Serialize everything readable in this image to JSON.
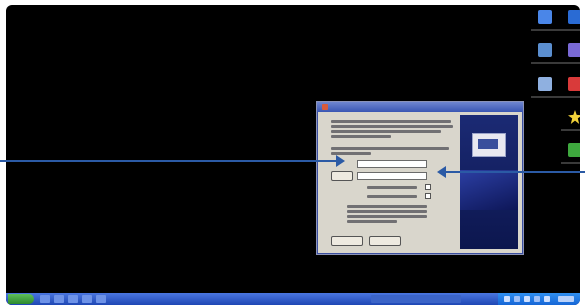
{
  "screen": {
    "background_color": "#000000",
    "accent_color": "#2b5aa5"
  },
  "desktop_icons": [
    {
      "name": "my-computer-icon",
      "color": "#4a86e8"
    },
    {
      "name": "network-icon",
      "color": "#2a6bd4"
    },
    {
      "name": "network-places-icon",
      "color": "#5b8fd0"
    },
    {
      "name": "user-icon",
      "color": "#7a6ad6"
    },
    {
      "name": "recycle-bin-icon",
      "color": "#8fb0e0"
    },
    {
      "name": "application-icon",
      "color": "#d93a3a"
    },
    {
      "name": "star-icon",
      "color": "#f2d23a"
    },
    {
      "name": "green-app-icon",
      "color": "#3ea83e"
    }
  ],
  "dialog": {
    "title": "",
    "buttons": [
      {
        "label": ""
      },
      {
        "label": ""
      }
    ]
  },
  "taskbar": {
    "start_label": ""
  }
}
